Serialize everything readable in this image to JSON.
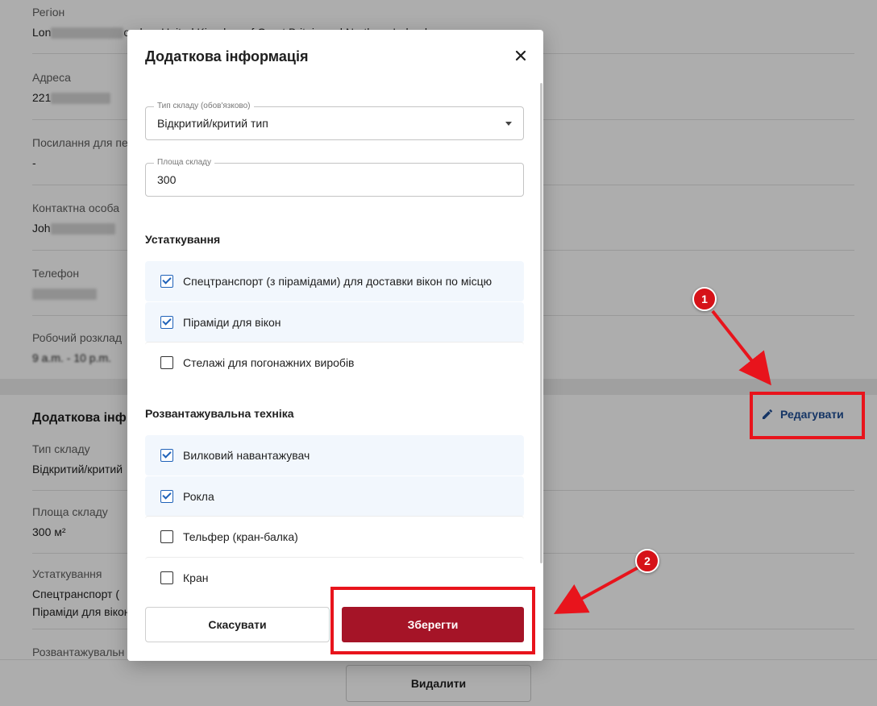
{
  "background": {
    "fields": [
      {
        "label": "Регіон",
        "value": "Lon",
        "value_tail": "ondon, United Kingdom of Great Britain and Northern Ireland"
      },
      {
        "label": "Адреса",
        "value": "221"
      },
      {
        "label": "Посилання для пе",
        "value": "-"
      },
      {
        "label": "Контактна особа",
        "value": "Joh"
      },
      {
        "label": "Телефон",
        "value": ""
      },
      {
        "label": "Робочий розклад",
        "value": "9 a.m. - 10 p.m."
      }
    ],
    "additional": {
      "title": "Додаткова інф",
      "edit_label": "Редагувати",
      "fields": [
        {
          "label": "Тип складу",
          "value": "Відкритий/критий"
        },
        {
          "label": "Площа складу",
          "value": "300 м²"
        },
        {
          "label": "Устаткування",
          "value": "Спецтранспорт (",
          "value2": "Піраміди для вікон"
        },
        {
          "label": "Розвантажувальн",
          "value": ""
        }
      ]
    },
    "delete_label": "Видалити"
  },
  "modal": {
    "title": "Додаткова інформація",
    "close_icon": "close-icon",
    "warehouse_type": {
      "legend": "Тип складу (обов'язково)",
      "value": "Відкритий/критий тип"
    },
    "area": {
      "legend": "Площа складу",
      "value": "300"
    },
    "equipment": {
      "title": "Устаткування",
      "items": [
        {
          "label": "Спецтранспорт (з пірамідами) для доставки вікон по місцю",
          "checked": true
        },
        {
          "label": "Піраміди для вікон",
          "checked": true
        },
        {
          "label": "Стелажі для погонажних виробів",
          "checked": false
        }
      ]
    },
    "unloading": {
      "title": "Розвантажувальна техніка",
      "items": [
        {
          "label": "Вилковий навантажувач",
          "checked": true
        },
        {
          "label": "Рокла",
          "checked": true
        },
        {
          "label": "Тельфер (кран-балка)",
          "checked": false
        },
        {
          "label": "Кран",
          "checked": false
        }
      ]
    },
    "cancel_label": "Скасувати",
    "save_label": "Зберегти"
  },
  "annotations": {
    "badge1": "1",
    "badge2": "2",
    "color": "#e8141c"
  },
  "colors": {
    "accent_red": "#a51427",
    "link_blue": "#1f4e96",
    "checkbox_blue": "#1f62b9"
  }
}
